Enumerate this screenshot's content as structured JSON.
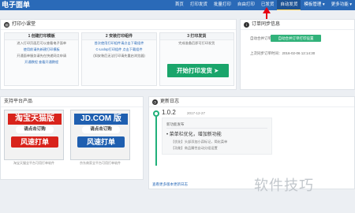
{
  "header": {
    "app_title": "电子面单",
    "nav": [
      "首页",
      "打印发货",
      "批量打印",
      "自由打印",
      "已发货",
      "自动发货",
      "模板管理 ▾",
      "更多功能 ▾"
    ],
    "active_index": 5
  },
  "guide": {
    "title": "打印小课堂",
    "steps": [
      {
        "title": "1 创建打印模板",
        "lines": [
          "进入打印页面后可以查看电子面单",
          "使用前请先新建打印模板",
          "开通面单服务请先在快递网点申请",
          "开通教程 查看开通教程"
        ]
      },
      {
        "title": "2 安装打印组件",
        "lines": [
          "首次使用打印组件请点击下载组件",
          "C-Lodop打印组件 点击下载组件",
          "(如安装后无法打印请先重启浏览器)"
        ]
      },
      {
        "title": "3 打印发货",
        "lines": [
          "完成准备后即可打印发货"
        ],
        "button": "开始打印发货"
      }
    ]
  },
  "info": {
    "title": "订单同步信息",
    "rows": [
      "自动合并订单",
      "上次同步订单时间：2016-02-06 12:14:30"
    ],
    "button": "自动合并订单打印设置"
  },
  "platforms": {
    "title": "支持平台产品",
    "cards": [
      {
        "logo": "淘宝天猫版",
        "tag": "请点击订购",
        "action": "风速打单",
        "caption": "淘宝天猫全平台可用打单软件",
        "color": "#d8231b"
      },
      {
        "logo": "JD.COM 版",
        "tag": "请点击订购",
        "action": "风速打单",
        "caption": "京东商家全平台可用打单软件",
        "color": "#1f5fb0"
      }
    ]
  },
  "changelog": {
    "title": "更新日志",
    "version": "1.0.2",
    "date": "2017-12-27",
    "subtitle": "新功能发布",
    "main": "• 菜单栏优化，增加新功能",
    "items": [
      "【优化】头部添加小蒜标记，简化菜单",
      "【功能】商品属性自动分组设置"
    ],
    "more": "查看更多版本更新日志"
  },
  "watermark": "软件技巧"
}
